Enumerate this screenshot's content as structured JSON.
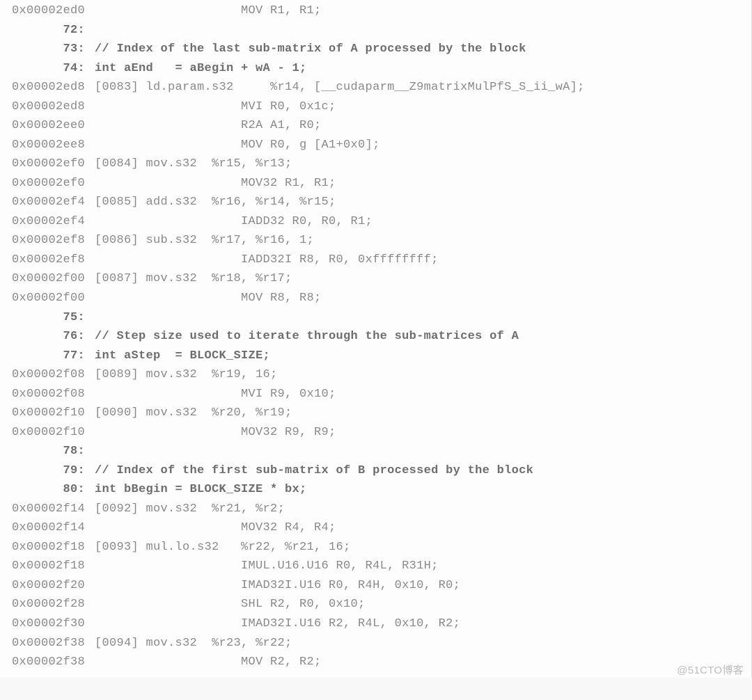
{
  "rows": [
    {
      "addr": "0x00002ed0",
      "type": "asm",
      "text": "                    MOV R1, R1;"
    },
    {
      "addr": "72:",
      "type": "lineno",
      "text": ""
    },
    {
      "addr": "73:",
      "type": "src",
      "text": "// Index of the last sub-matrix of A processed by the block"
    },
    {
      "addr": "74:",
      "type": "src",
      "text": "int aEnd   = aBegin + wA - 1;"
    },
    {
      "addr": "0x00002ed8",
      "type": "asm",
      "text": "[0083] ld.param.s32     %r14, [__cudaparm__Z9matrixMulPfS_S_ii_wA];"
    },
    {
      "addr": "0x00002ed8",
      "type": "asm",
      "text": "                    MVI R0, 0x1c;"
    },
    {
      "addr": "0x00002ee0",
      "type": "asm",
      "text": "                    R2A A1, R0;"
    },
    {
      "addr": "0x00002ee8",
      "type": "asm",
      "text": "                    MOV R0, g [A1+0x0];"
    },
    {
      "addr": "0x00002ef0",
      "type": "asm",
      "text": "[0084] mov.s32  %r15, %r13;"
    },
    {
      "addr": "0x00002ef0",
      "type": "asm",
      "text": "                    MOV32 R1, R1;"
    },
    {
      "addr": "0x00002ef4",
      "type": "asm",
      "text": "[0085] add.s32  %r16, %r14, %r15;"
    },
    {
      "addr": "0x00002ef4",
      "type": "asm",
      "text": "                    IADD32 R0, R0, R1;"
    },
    {
      "addr": "0x00002ef8",
      "type": "asm",
      "text": "[0086] sub.s32  %r17, %r16, 1;"
    },
    {
      "addr": "0x00002ef8",
      "type": "asm",
      "text": "                    IADD32I R8, R0, 0xffffffff;"
    },
    {
      "addr": "0x00002f00",
      "type": "asm",
      "text": "[0087] mov.s32  %r18, %r17;"
    },
    {
      "addr": "0x00002f00",
      "type": "asm",
      "text": "                    MOV R8, R8;"
    },
    {
      "addr": "75:",
      "type": "lineno",
      "text": ""
    },
    {
      "addr": "76:",
      "type": "src",
      "text": "// Step size used to iterate through the sub-matrices of A"
    },
    {
      "addr": "77:",
      "type": "src",
      "text": "int aStep  = BLOCK_SIZE;"
    },
    {
      "addr": "0x00002f08",
      "type": "asm",
      "text": "[0089] mov.s32  %r19, 16;"
    },
    {
      "addr": "0x00002f08",
      "type": "asm",
      "text": "                    MVI R9, 0x10;"
    },
    {
      "addr": "0x00002f10",
      "type": "asm",
      "text": "[0090] mov.s32  %r20, %r19;"
    },
    {
      "addr": "0x00002f10",
      "type": "asm",
      "text": "                    MOV32 R9, R9;"
    },
    {
      "addr": "78:",
      "type": "lineno",
      "text": ""
    },
    {
      "addr": "79:",
      "type": "src",
      "text": "// Index of the first sub-matrix of B processed by the block"
    },
    {
      "addr": "80:",
      "type": "src",
      "text": "int bBegin = BLOCK_SIZE * bx;"
    },
    {
      "addr": "0x00002f14",
      "type": "asm",
      "text": "[0092] mov.s32  %r21, %r2;"
    },
    {
      "addr": "0x00002f14",
      "type": "asm",
      "text": "                    MOV32 R4, R4;"
    },
    {
      "addr": "0x00002f18",
      "type": "asm",
      "text": "[0093] mul.lo.s32   %r22, %r21, 16;"
    },
    {
      "addr": "0x00002f18",
      "type": "asm",
      "text": "                    IMUL.U16.U16 R0, R4L, R31H;"
    },
    {
      "addr": "0x00002f20",
      "type": "asm",
      "text": "                    IMAD32I.U16 R0, R4H, 0x10, R0;"
    },
    {
      "addr": "0x00002f28",
      "type": "asm",
      "text": "                    SHL R2, R0, 0x10;"
    },
    {
      "addr": "0x00002f30",
      "type": "asm",
      "text": "                    IMAD32I.U16 R2, R4L, 0x10, R2;"
    },
    {
      "addr": "0x00002f38",
      "type": "asm",
      "text": "[0094] mov.s32  %r23, %r22;"
    },
    {
      "addr": "0x00002f38",
      "type": "asm",
      "text": "                    MOV R2, R2;"
    }
  ],
  "watermark": "@51CTO博客"
}
